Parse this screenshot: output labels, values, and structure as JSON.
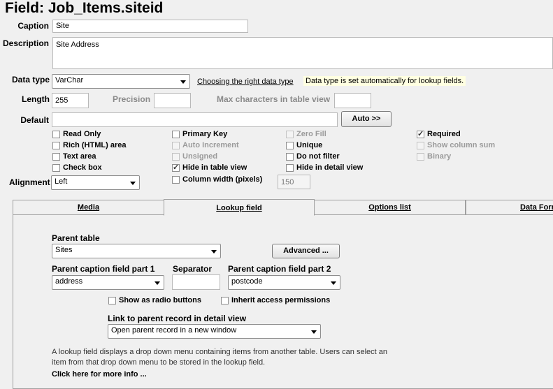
{
  "header": {
    "title": "Field: Job_Items.siteid"
  },
  "caption": {
    "label": "Caption",
    "value": "Site"
  },
  "description": {
    "label": "Description",
    "value": "Site Address"
  },
  "data_type": {
    "label": "Data type",
    "selected": "VarChar",
    "help_link": "Choosing the right data type",
    "note": "Data type is set automatically for lookup fields."
  },
  "length": {
    "label": "Length",
    "value": "255"
  },
  "precision": {
    "label": "Precision",
    "value": ""
  },
  "max_chars": {
    "label": "Max characters in table view",
    "value": ""
  },
  "default": {
    "label": "Default",
    "value": "",
    "auto_button": "Auto >>"
  },
  "options": {
    "read_only": {
      "label": "Read Only",
      "checked": false
    },
    "rich_html": {
      "label": "Rich (HTML) area",
      "checked": false
    },
    "text_area": {
      "label": "Text area",
      "checked": false
    },
    "check_box": {
      "label": "Check box",
      "checked": false
    },
    "primary_key": {
      "label": "Primary Key",
      "checked": false
    },
    "auto_increment": {
      "label": "Auto Increment",
      "checked": false,
      "enabled": false
    },
    "unsigned": {
      "label": "Unsigned",
      "checked": false,
      "enabled": false
    },
    "hide_table": {
      "label": "Hide in table view",
      "checked": true
    },
    "column_width": {
      "label": "Column width (pixels)",
      "checked": false,
      "value": "150"
    },
    "zero_fill": {
      "label": "Zero Fill",
      "checked": false,
      "enabled": false
    },
    "unique": {
      "label": "Unique",
      "checked": false
    },
    "no_filter": {
      "label": "Do not filter",
      "checked": false
    },
    "hide_detail": {
      "label": "Hide in detail view",
      "checked": false
    },
    "required": {
      "label": "Required",
      "checked": true
    },
    "column_sum": {
      "label": "Show column sum",
      "checked": false,
      "enabled": false
    },
    "binary": {
      "label": "Binary",
      "checked": false,
      "enabled": false
    }
  },
  "alignment": {
    "label": "Alignment",
    "selected": "Left"
  },
  "tabs": [
    {
      "label": "Media",
      "active": false
    },
    {
      "label": "Lookup field",
      "active": true
    },
    {
      "label": "Options list",
      "active": false
    },
    {
      "label": "Data Format",
      "active": false
    }
  ],
  "lookup": {
    "parent_table_label": "Parent table",
    "parent_table": "Sites",
    "advanced_button": "Advanced ...",
    "part1_label": "Parent caption field part 1",
    "part1": "address",
    "separator_label": "Separator",
    "separator": "",
    "part2_label": "Parent caption field part 2",
    "part2": "postcode",
    "radio_label": "Show as radio buttons",
    "inherit_label": "Inherit access permissions",
    "link_label": "Link to parent record in detail view",
    "link_value": "Open parent record in a new window",
    "help_text": "A lookup field displays a drop down menu containing items from another table. Users can select an item from that drop down menu to be stored in the lookup field.",
    "more_info": "Click here for more info ..."
  }
}
